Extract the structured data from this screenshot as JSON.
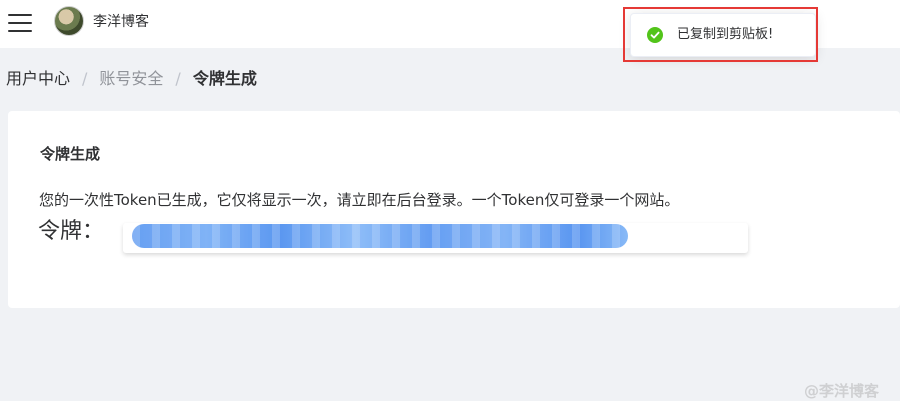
{
  "header": {
    "username": "李洋博客"
  },
  "toast": {
    "message": "已复制到剪贴板!",
    "icon": "check-circle-icon",
    "color": "#52c41a"
  },
  "breadcrumb": {
    "items": [
      "用户中心",
      "账号安全",
      "令牌生成"
    ],
    "separator": "/"
  },
  "card": {
    "title": "令牌生成",
    "description": "您的一次性Token已生成，它仅将显示一次，请立即在后台登录。一个Token仅可登录一个网站。",
    "token_label": "令牌："
  },
  "watermark": "@李洋博客",
  "colors": {
    "page_background": "#f0f2f5",
    "highlight": "#e53935",
    "token_blur": "#4d8ff0"
  }
}
